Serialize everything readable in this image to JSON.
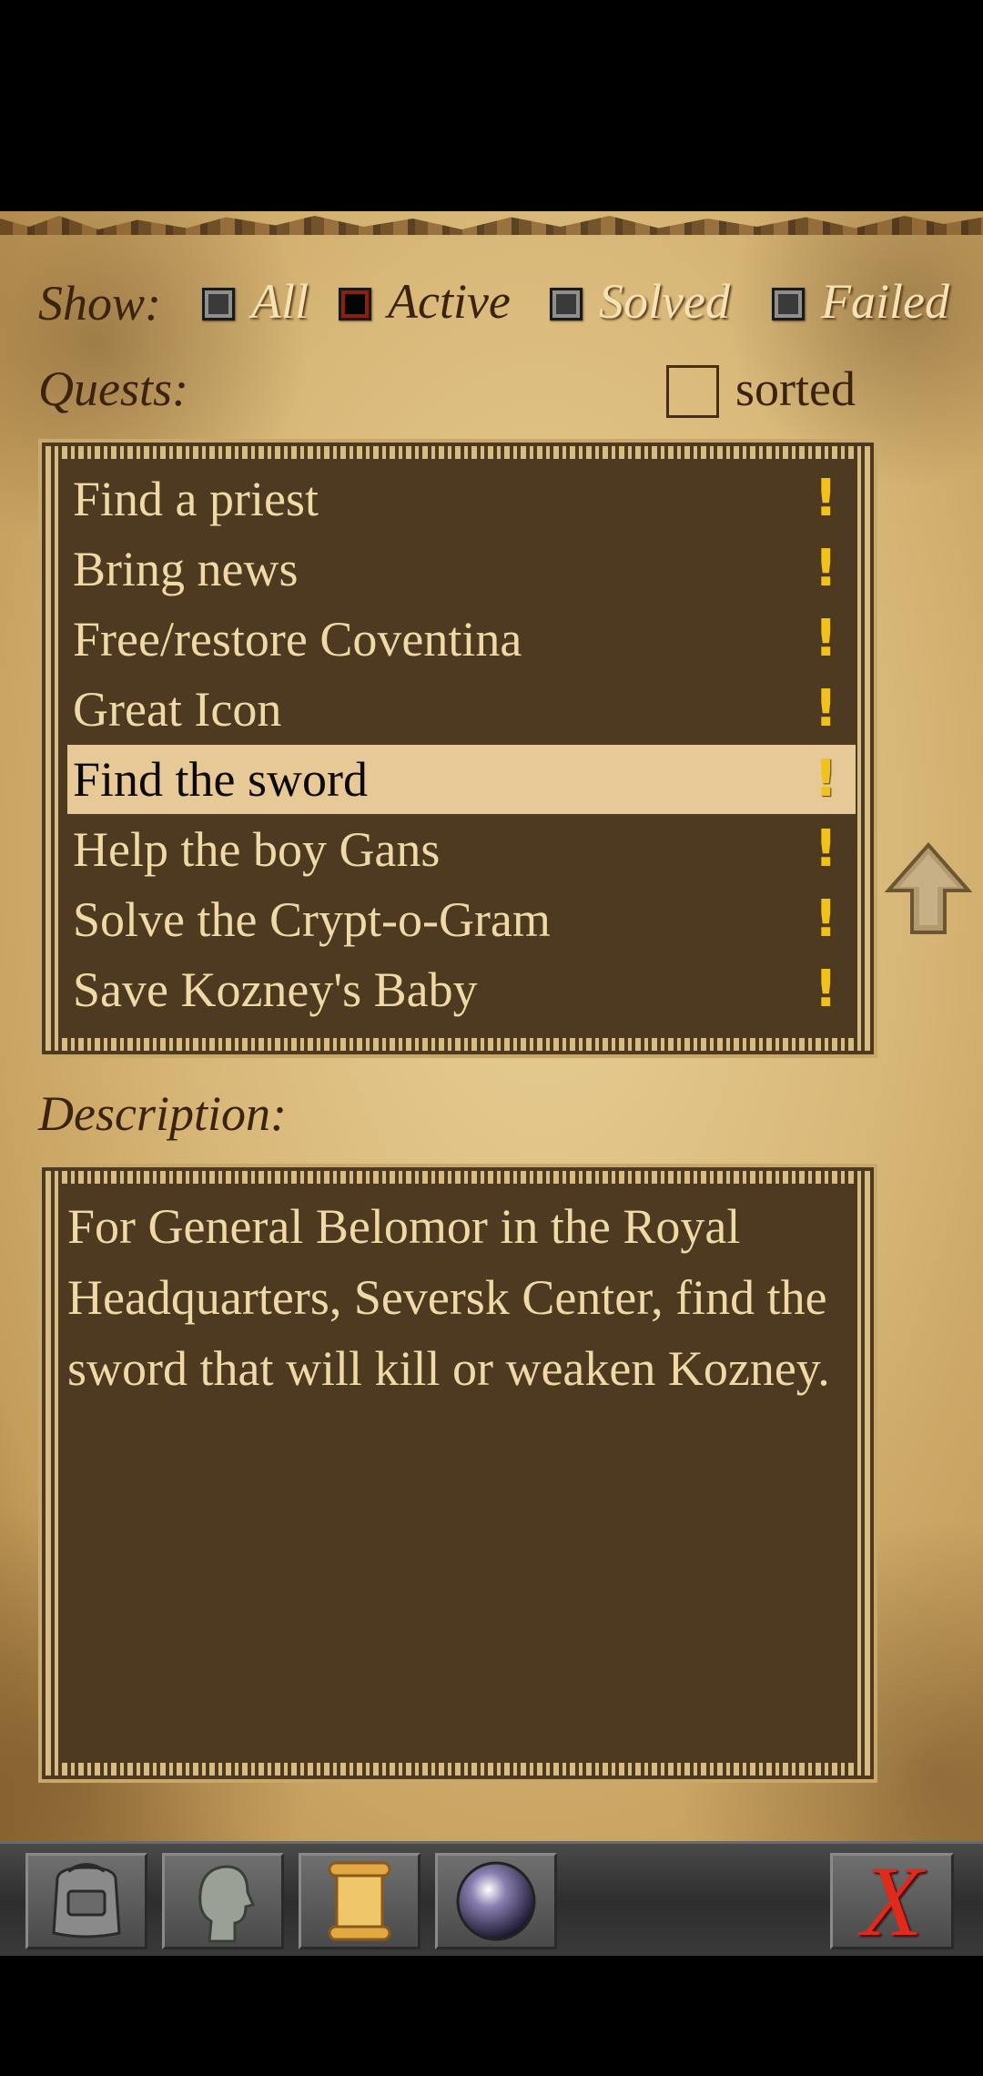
{
  "filter": {
    "show_label": "Show:",
    "options": [
      {
        "label": "All",
        "checked": false
      },
      {
        "label": "Active",
        "checked": true
      },
      {
        "label": "Solved",
        "checked": false
      },
      {
        "label": "Failed",
        "checked": false
      }
    ]
  },
  "quests": {
    "header": "Quests:",
    "sorted_label": "sorted",
    "sorted_checked": false,
    "items": [
      {
        "title": "Find a priest",
        "marker": "!"
      },
      {
        "title": "Bring news",
        "marker": "!"
      },
      {
        "title": "Free/restore Coventina",
        "marker": "!"
      },
      {
        "title": "Great Icon",
        "marker": "!"
      },
      {
        "title": "Find the sword",
        "marker": "!",
        "selected": true
      },
      {
        "title": "Help the boy Gans",
        "marker": "!"
      },
      {
        "title": "Solve the Crypt-o-Gram",
        "marker": "!"
      },
      {
        "title": "Save Kozney's Baby",
        "marker": "!"
      }
    ]
  },
  "description": {
    "header": "Description:",
    "text": "For General Belomor in the Royal Headquarters, Seversk Center, find the sword that will kill or weaken Kozney."
  },
  "toolbar": {
    "buttons": [
      {
        "icon": "backpack-icon"
      },
      {
        "icon": "head-icon"
      },
      {
        "icon": "scroll-icon"
      },
      {
        "icon": "crystal-orb-icon"
      }
    ],
    "close_label": "X"
  },
  "colors": {
    "parchment": "#d9b97a",
    "panel": "#4d3a20",
    "panel_text": "#efd9a6",
    "selected_row": "#e6c996",
    "marker": "#f2c21c",
    "close": "#e22a1a"
  }
}
